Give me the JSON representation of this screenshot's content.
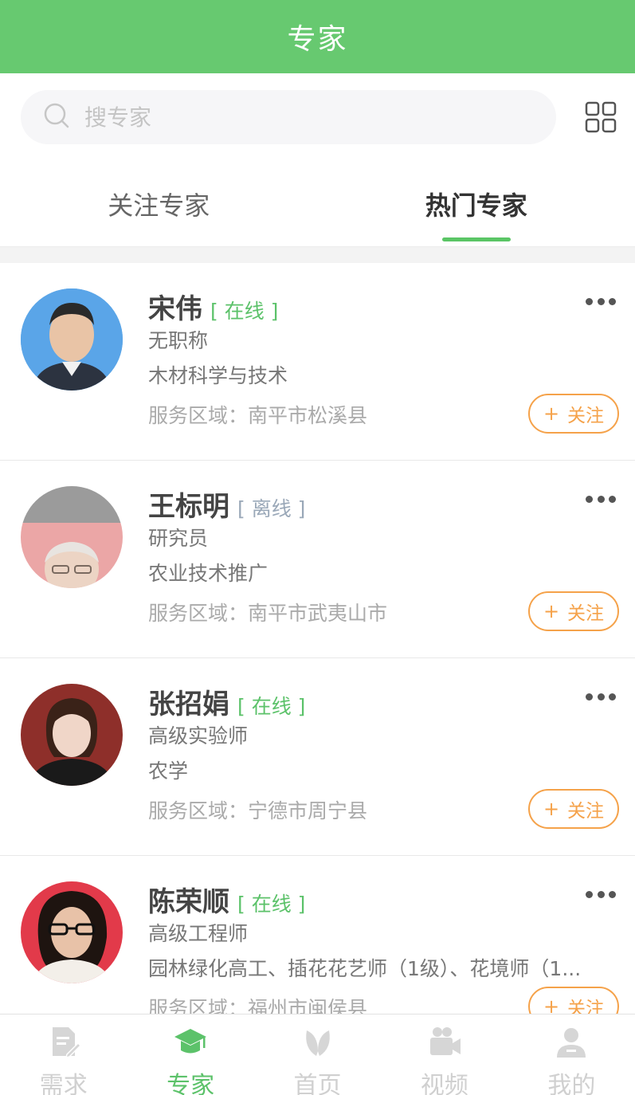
{
  "header": {
    "title": "专家"
  },
  "search": {
    "placeholder": "搜专家"
  },
  "tabs": [
    {
      "label": "关注专家",
      "active": false
    },
    {
      "label": "热门专家",
      "active": true
    }
  ],
  "experts": [
    {
      "name": "宋伟",
      "status": "[ 在线 ]",
      "online": true,
      "title": "无职称",
      "field": "木材科学与技术",
      "area": "服务区域：南平市松溪县",
      "follow_label": "关注"
    },
    {
      "name": "王标明",
      "status": "[ 离线 ]",
      "online": false,
      "title": "研究员",
      "field": "农业技术推广",
      "area": "服务区域：南平市武夷山市",
      "follow_label": "关注"
    },
    {
      "name": "张招娟",
      "status": "[ 在线 ]",
      "online": true,
      "title": "高级实验师",
      "field": "农学",
      "area": "服务区域：宁德市周宁县",
      "follow_label": "关注"
    },
    {
      "name": "陈荣顺",
      "status": "[ 在线 ]",
      "online": true,
      "title": "高级工程师",
      "field": "园林绿化高工、插花花艺师（1级）、花境师（1...",
      "area": "服务区域：福州市闽侯县",
      "follow_label": "关注"
    }
  ],
  "bottom_nav": [
    {
      "label": "需求",
      "icon": "document-edit-icon",
      "active": false
    },
    {
      "label": "专家",
      "icon": "graduation-cap-icon",
      "active": true
    },
    {
      "label": "首页",
      "icon": "leaf-icon",
      "active": false
    },
    {
      "label": "视频",
      "icon": "video-camera-icon",
      "active": false
    },
    {
      "label": "我的",
      "icon": "user-icon",
      "active": false
    }
  ],
  "colors": {
    "primary_green": "#67c970",
    "follow_orange": "#f5a24a",
    "offline_gray": "#9aa8b8"
  }
}
